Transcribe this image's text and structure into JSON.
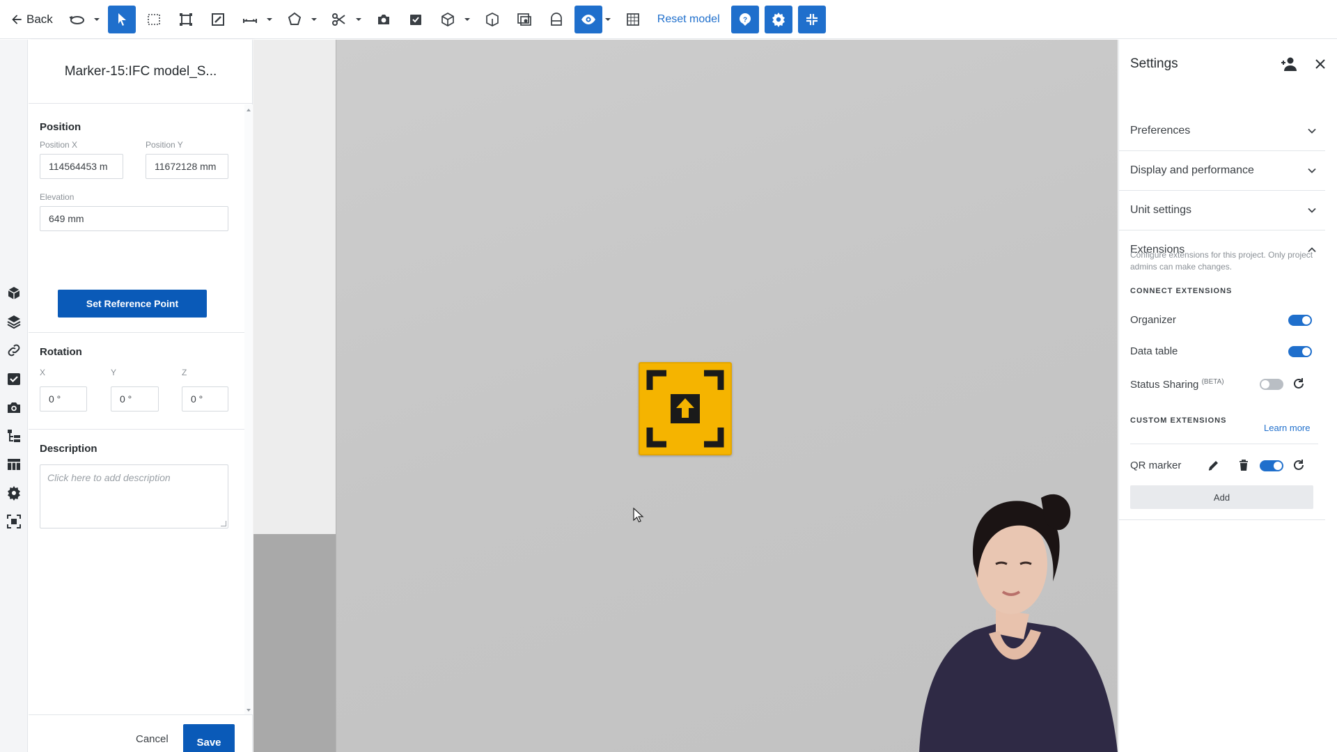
{
  "toolbar": {
    "back_label": "Back",
    "reset_label": "Reset model",
    "tools": [
      "orbit-icon",
      "select-icon",
      "box-select-icon",
      "section-box-icon",
      "markup-icon",
      "measure-icon",
      "shape-icon",
      "clip-icon",
      "camera-icon",
      "todo-icon",
      "cube-icon",
      "isolate-icon",
      "views-icon",
      "object-icon",
      "visibility-icon",
      "grid-icon",
      "help-icon",
      "settings-icon",
      "fit-icon"
    ],
    "accent": "#1f6fcc"
  },
  "panel": {
    "title": "Marker-15:IFC model_S...",
    "position": {
      "heading": "Position",
      "x_label": "Position X",
      "x_value": "114564453 m",
      "y_label": "Position Y",
      "y_value": "11672128 mm",
      "elevation_label": "Elevation",
      "elevation_value": "649 mm"
    },
    "set_reference_label": "Set Reference Point",
    "rotation": {
      "heading": "Rotation",
      "x_label": "X",
      "x_value": "0 °",
      "y_label": "Y",
      "y_value": "0 °",
      "z_label": "Z",
      "z_value": "0 °"
    },
    "description": {
      "heading": "Description",
      "placeholder": "Click here to add description"
    },
    "cancel_label": "Cancel",
    "save_label": "Save",
    "button_color": "#0a5ab8"
  },
  "rail": [
    "models-icon",
    "layers-icon",
    "link-icon",
    "todo-icon",
    "camera-icon",
    "organizer-icon",
    "table-icon",
    "extensions-icon",
    "marker-icon"
  ],
  "viewport": {
    "marker_color": "#f5b400"
  },
  "settings": {
    "title": "Settings",
    "sections": {
      "preferences": "Preferences",
      "display": "Display and performance",
      "units": "Unit settings",
      "extensions": "Extensions"
    },
    "ext_description": "Configure extensions for this project. Only project admins can make changes.",
    "connect_heading": "CONNECT EXTENSIONS",
    "organizer": {
      "label": "Organizer",
      "enabled": true
    },
    "data_table": {
      "label": "Data table",
      "enabled": true
    },
    "status_sharing": {
      "label": "Status Sharing",
      "badge": "(BETA)",
      "enabled": false
    },
    "custom_heading": "CUSTOM EXTENSIONS",
    "learn_more": "Learn more",
    "qr_marker": {
      "label": "QR marker",
      "enabled": true
    },
    "add_label": "Add"
  }
}
